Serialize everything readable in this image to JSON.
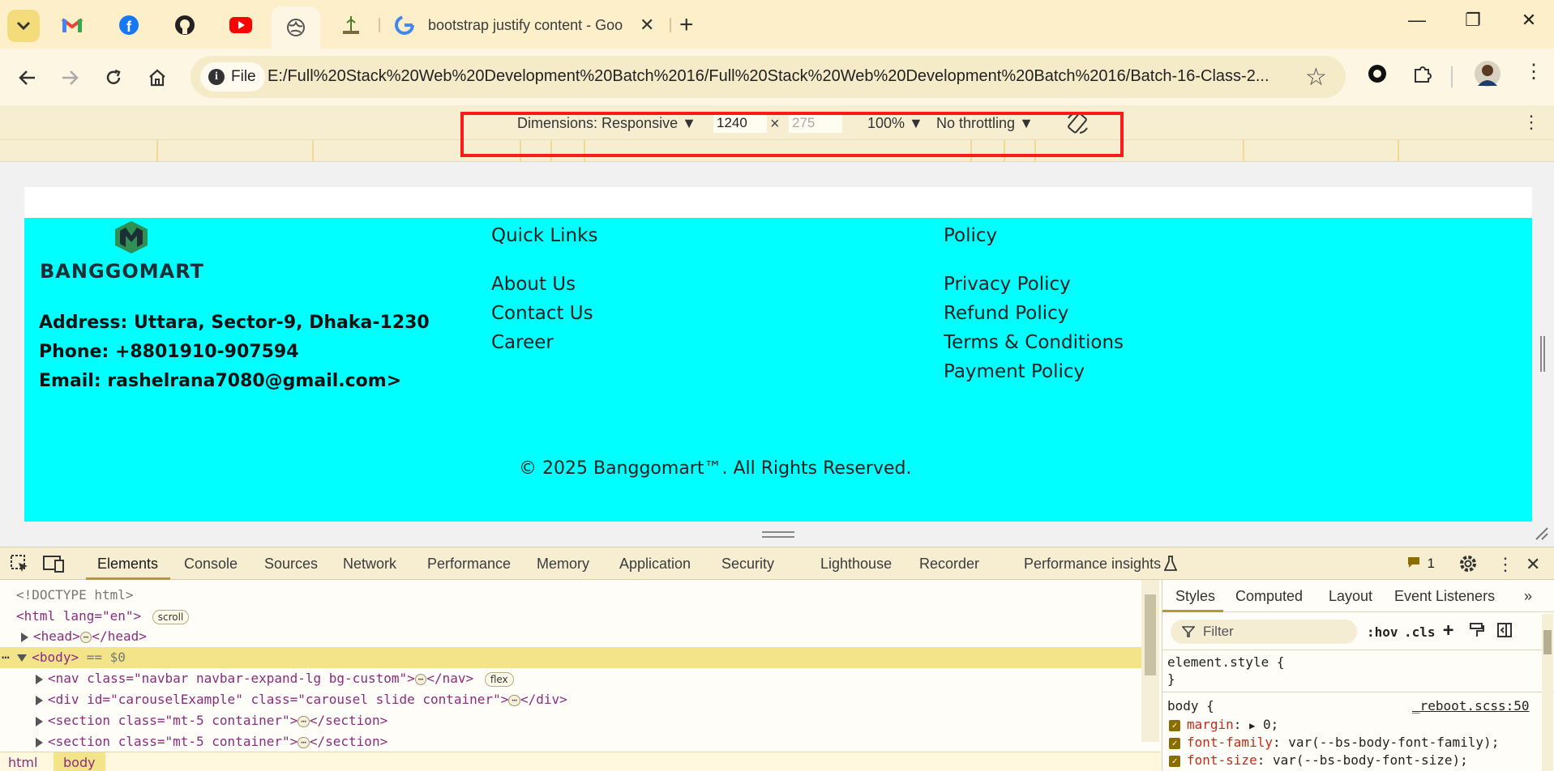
{
  "browser": {
    "active_tab_title": "bootstrap justify content - Goo",
    "address_chip": "File",
    "url": "E:/Full%20Stack%20Web%20Development%20Batch%2016/Full%20Stack%20Web%20Development%20Batch%2016/Batch-16-Class-2..."
  },
  "device_toolbar": {
    "dimensions_label": "Dimensions: Responsive",
    "width": "1240",
    "height_placeholder": "275",
    "times": "×",
    "zoom": "100%",
    "throttling": "No throttling"
  },
  "page": {
    "logo_text": "BANGGOMART",
    "address": "Address: Uttara, Sector-9, Dhaka-1230",
    "phone": "Phone: +8801910-907594",
    "email": "Email: rashelrana7080@gmail.com>",
    "quick_links": {
      "title": "Quick Links",
      "items": [
        "About Us",
        "Contact Us",
        "Career"
      ]
    },
    "policy": {
      "title": "Policy",
      "items": [
        "Privacy Policy",
        "Refund Policy",
        "Terms & Conditions",
        "Payment Policy"
      ]
    },
    "copyright": "© 2025 Banggomart™. All Rights Reserved.",
    "footer_bg": "#00ffff"
  },
  "devtools": {
    "tabs": [
      "Elements",
      "Console",
      "Sources",
      "Network",
      "Performance",
      "Memory",
      "Application",
      "Security",
      "Lighthouse",
      "Recorder",
      "Performance insights"
    ],
    "issues_count": "1",
    "elements": {
      "doctype": "<!DOCTYPE html>",
      "html_open": "<html lang=\"en\">",
      "scroll_pill": "scroll",
      "head": "<head>",
      "head_close": "</head>",
      "body_open": "<body>",
      "body_marker": "== $0",
      "nav_tag": "<nav class=\"navbar navbar-expand-lg bg-custom\">",
      "nav_close": "</nav>",
      "flex_pill": "flex",
      "div_tag": "<div id=\"carouselExample\" class=\"carousel slide container\">",
      "div_close": "</div>",
      "section1_tag": "<section class=\"mt-5 container\">",
      "section1_close": "</section>",
      "section2_tag": "<section class=\"mt-5 container\">",
      "section2_close": "</section>"
    },
    "breadcrumbs": [
      "html",
      "body"
    ],
    "styles": {
      "tabs": [
        "Styles",
        "Computed",
        "Layout",
        "Event Listeners"
      ],
      "filter_placeholder": "Filter",
      "hov": ":hov",
      "cls": ".cls",
      "element_style_open": "element.style {",
      "element_style_close": "}",
      "body_selector": "body {",
      "source": "_reboot.scss:50",
      "rules": [
        {
          "prop": "margin",
          "value": "0;"
        },
        {
          "prop": "font-family",
          "value": "var(--bs-body-font-family);"
        },
        {
          "prop": "font-size",
          "value": "var(--bs-body-font-size);"
        }
      ]
    }
  }
}
